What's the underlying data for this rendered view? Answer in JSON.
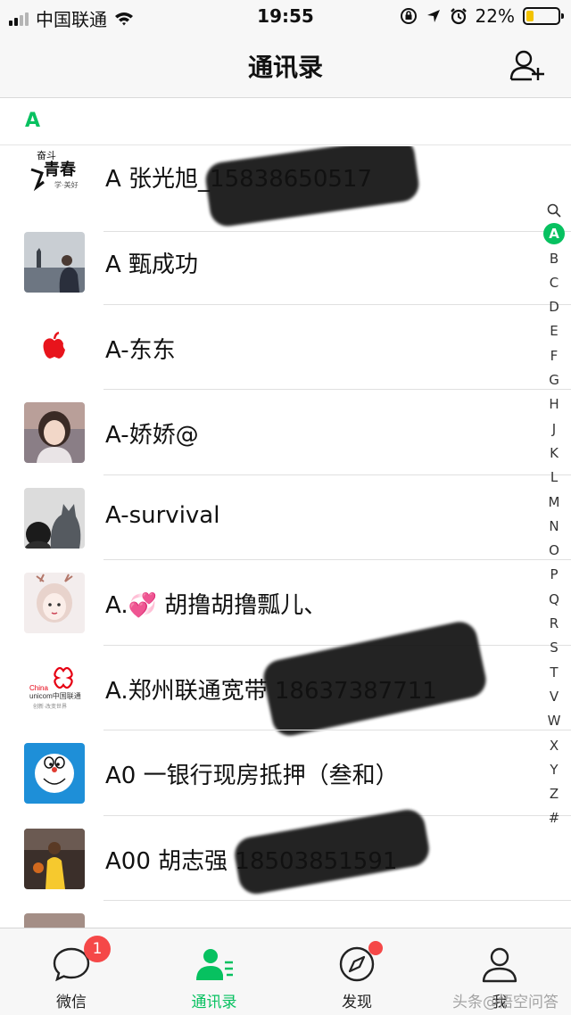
{
  "status_bar": {
    "carrier": "中国联通",
    "time": "19:55",
    "battery": "22%",
    "battery_level": 0.22,
    "signal_bars": 2,
    "icons": [
      "signal-icon",
      "wifi-icon",
      "orientation-lock-icon",
      "location-icon",
      "alarm-icon",
      "battery-icon"
    ]
  },
  "nav": {
    "title": "通讯录",
    "add_icon": "add-friend-icon"
  },
  "section": {
    "letter": "A"
  },
  "contacts": [
    {
      "name": "A 张光旭_15838650517",
      "avatar": "poster-avatar"
    },
    {
      "name": "A 甄成功",
      "avatar": "statue-photo-avatar"
    },
    {
      "name": "A-东东",
      "avatar": "apple-logo-avatar"
    },
    {
      "name": "A-娇娇@",
      "avatar": "girl-photo-avatar"
    },
    {
      "name": "A-survival",
      "avatar": "cat-photo-avatar"
    },
    {
      "name": "A.💞 胡撸胡撸瓢儿、",
      "avatar": "girl-sketch-avatar"
    },
    {
      "name": "A.郑州联通宽带 18637387711",
      "avatar": "china-unicom-logo-avatar"
    },
    {
      "name": "A0 一银行现房抵押（叁和）",
      "avatar": "doraemon-avatar"
    },
    {
      "name": "A00 胡志强 18503851591",
      "avatar": "basketball-player-avatar"
    }
  ],
  "index_bar": [
    "A",
    "B",
    "C",
    "D",
    "E",
    "F",
    "G",
    "H",
    "J",
    "K",
    "L",
    "M",
    "N",
    "O",
    "P",
    "Q",
    "R",
    "S",
    "T",
    "V",
    "W",
    "X",
    "Y",
    "Z",
    "#"
  ],
  "index_active": "A",
  "tabs": [
    {
      "label": "微信",
      "icon": "chat-bubble-icon",
      "badge": "1"
    },
    {
      "label": "通讯录",
      "icon": "contacts-icon",
      "active": true
    },
    {
      "label": "发现",
      "icon": "compass-icon",
      "dot": true
    },
    {
      "label": "我",
      "icon": "profile-icon"
    }
  ],
  "watermark": "头条@悟空问答",
  "colors": {
    "accent": "#07c160",
    "badge": "#f54848",
    "bar_bg": "#f7f7f7",
    "battery": "#f3c300"
  }
}
